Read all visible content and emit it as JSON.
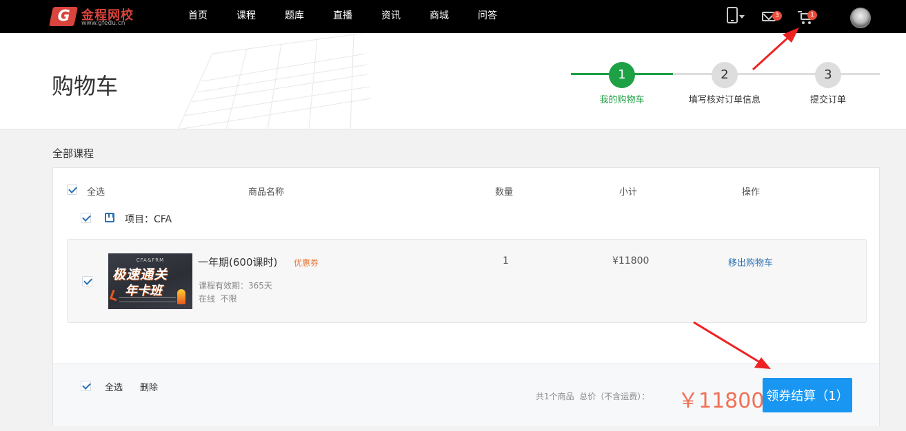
{
  "brand": {
    "name": "金程网校",
    "url": "www.gfedu.cn",
    "logo_letter": "G",
    "accent": "#d9443c"
  },
  "nav": {
    "items": [
      "首页",
      "课程",
      "题库",
      "直播",
      "资讯",
      "商城",
      "问答"
    ]
  },
  "topbar": {
    "mail_count": "3",
    "cart_count": "1"
  },
  "page": {
    "title": "购物车"
  },
  "steps": [
    {
      "number": "1",
      "label": "我的购物车",
      "active": true
    },
    {
      "number": "2",
      "label": "填写核对订单信息",
      "active": false
    },
    {
      "number": "3",
      "label": "提交订单",
      "active": false
    }
  ],
  "section": {
    "title": "全部课程"
  },
  "table": {
    "select_all": "全选",
    "headers": {
      "name": "商品名称",
      "quantity": "数量",
      "subtotal": "小计",
      "action": "操作"
    },
    "project_label": "项目：CFA"
  },
  "item": {
    "thumb_top": "CFA&FRM",
    "thumb_line1": "极速通关",
    "thumb_line2": "年卡班",
    "title": "一年期(600课时)",
    "coupon": "优惠券",
    "validity": "课程有效期：365天",
    "mode": "在线  不限",
    "quantity": "1",
    "subtotal": "¥11800",
    "remove": "移出购物车"
  },
  "footer": {
    "select_all": "全选",
    "delete": "删除",
    "summary": "共1个商品  总价（不含运费）：",
    "total": "￥11800",
    "checkout": "领券结算（1）"
  },
  "colors": {
    "green": "#1ea045",
    "blue": "#1896f2",
    "price": "#f07156",
    "annotation_arrow": "#ee2222"
  }
}
